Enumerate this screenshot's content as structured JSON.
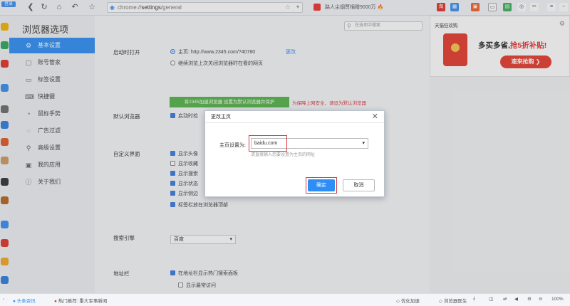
{
  "topbar": {
    "login": "登录",
    "url_prefix": "chrome://",
    "url_path": "settings",
    "url_suffix": "/general",
    "news": "路人尘烟贾捐赠9000万"
  },
  "nav": {
    "title": "浏览器选项",
    "items": [
      {
        "label": "基本设置",
        "icon": "gear-icon"
      },
      {
        "label": "账号管家",
        "icon": "account-icon"
      },
      {
        "label": "标签设置",
        "icon": "tab-icon"
      },
      {
        "label": "快捷键",
        "icon": "keyboard-icon"
      },
      {
        "label": "鼠标手势",
        "icon": "mouse-icon"
      },
      {
        "label": "广告过滤",
        "icon": "filter-icon"
      },
      {
        "label": "高级设置",
        "icon": "search-icon"
      },
      {
        "label": "我的应用",
        "icon": "apps-icon"
      },
      {
        "label": "关于我们",
        "icon": "info-icon"
      }
    ]
  },
  "main": {
    "search_placeholder": "在选项中搜索",
    "startup": {
      "label": "启动时打开",
      "home_option": "主页: http://www.2345.com/?40780",
      "change_link": "更改",
      "restore_option": "继续浏览上次关闭浏览器时在看的网页"
    },
    "default_browser": {
      "button": "将2345加速浏览器 设置为默认浏览器并保护",
      "warning": "为保障上网安全，请设为默认浏览器",
      "label": "默认浏览器",
      "check": "启动时检"
    },
    "ui": {
      "label": "自定义界面",
      "items": [
        "显示头像",
        "显示收藏",
        "显示搜索",
        "显示状态",
        "显示侧边",
        "标签栏放在浏览器顶部"
      ]
    },
    "search_engine": {
      "label": "搜索引擎",
      "value": "百度"
    },
    "address": {
      "label": "地址栏",
      "opt1": "在地址栏显示热门搜索面板",
      "opt2": "显示最常访问"
    }
  },
  "ad": {
    "header": "天猫狂欢购",
    "headline_a": "多买多省,",
    "headline_b": "抢5折补贴!",
    "cta": "速来抢购 ❯"
  },
  "modal": {
    "title": "更改主页",
    "field_label": "主页设置为:",
    "field_value": "baidu.com",
    "hint": "请直接输入您要设置为主页的网址",
    "ok": "确定",
    "cancel": "取消"
  },
  "status": {
    "news_label": "头条资讯",
    "hot": "热门推荐: 重大军事新闻",
    "speed": "优化加速",
    "doctor": "浏览器医生",
    "zoom": "100%"
  },
  "colors": {
    "accent": "#2f8ef5",
    "confirm": "#2f8ef5",
    "highlight": "#d9363e",
    "green": "#55b34a"
  }
}
